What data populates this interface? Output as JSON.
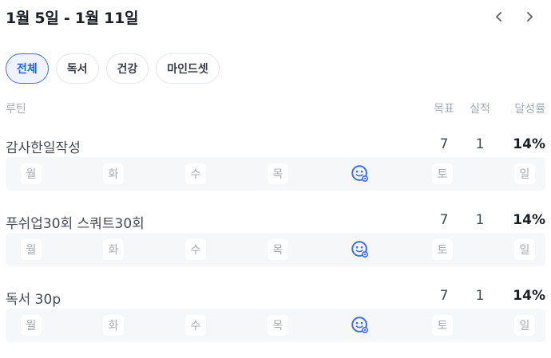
{
  "header": {
    "range_title": "1월 5일 - 1월 11일",
    "prev_icon": "chevron-left-icon",
    "next_icon": "chevron-right-icon"
  },
  "filters": [
    {
      "label": "전체",
      "active": true
    },
    {
      "label": "독서",
      "active": false
    },
    {
      "label": "건강",
      "active": false
    },
    {
      "label": "마인드셋",
      "active": false
    }
  ],
  "table_header": {
    "name": "루틴",
    "goal": "목표",
    "actual": "실적",
    "rate": "달성률"
  },
  "days": [
    "월",
    "화",
    "수",
    "목",
    "금",
    "토",
    "일"
  ],
  "done_icon": "smiley-check-icon",
  "colors": {
    "accent": "#3e6ff2",
    "chip_active_bg": "#eef3ff",
    "strip_bg": "#f6f7f9"
  },
  "routines": [
    {
      "name": "감사한일작성",
      "goal": "7",
      "actual": "1",
      "rate": "14%",
      "completed_days": [
        "금"
      ]
    },
    {
      "name": "푸쉬업30회 스쿼트30회",
      "goal": "7",
      "actual": "1",
      "rate": "14%",
      "completed_days": [
        "금"
      ]
    },
    {
      "name": "독서 30p",
      "goal": "7",
      "actual": "1",
      "rate": "14%",
      "completed_days": [
        "금"
      ]
    }
  ]
}
